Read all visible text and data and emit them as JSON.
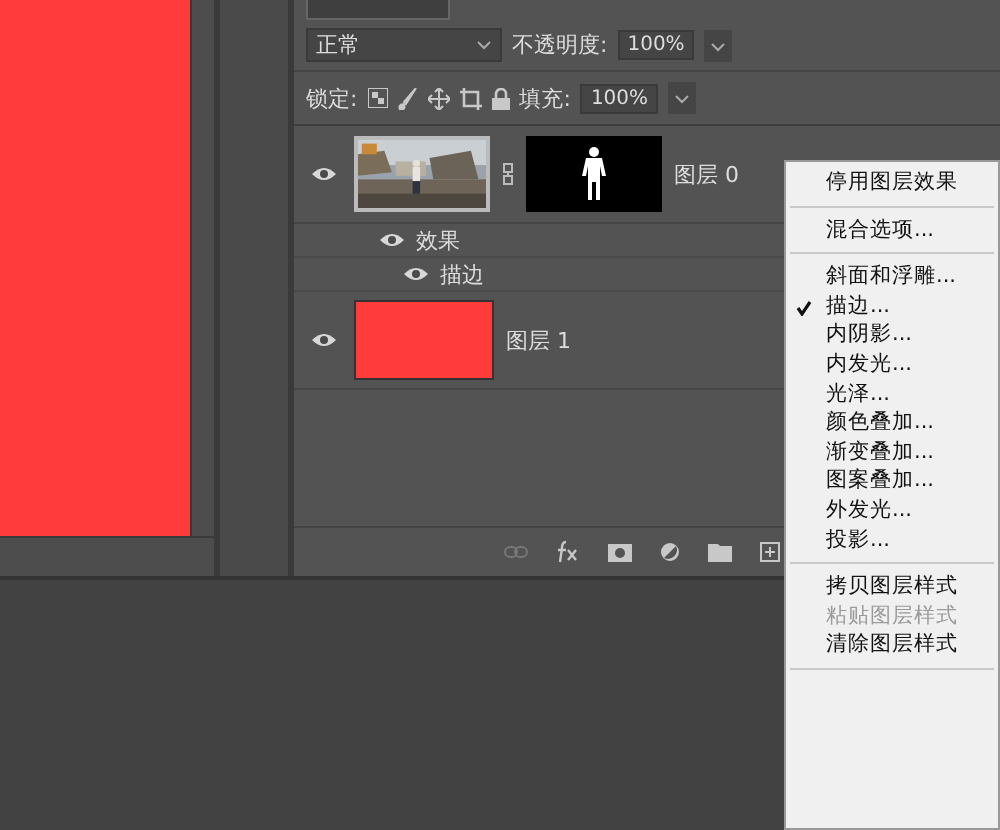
{
  "layers_panel": {
    "blend_mode": "正常",
    "opacity": {
      "label": "不透明度:",
      "value": "100%"
    },
    "lock": {
      "label": "锁定:"
    },
    "fill": {
      "label": "填充:",
      "value": "100%"
    },
    "layers": [
      {
        "name": "图层 0",
        "visible": true,
        "effects_label": "效果",
        "effects_visible": true,
        "effects": [
          {
            "name": "描边",
            "visible": true
          }
        ]
      },
      {
        "name": "图层 1",
        "kind": "solid",
        "visible": true
      }
    ]
  },
  "context_menu": [
    {
      "kind": "item",
      "label": "停用图层效果",
      "checked": false,
      "disabled": false
    },
    {
      "kind": "separator"
    },
    {
      "kind": "item",
      "label": "混合选项...",
      "checked": false,
      "disabled": false
    },
    {
      "kind": "separator"
    },
    {
      "kind": "item",
      "label": "斜面和浮雕...",
      "checked": false,
      "disabled": false
    },
    {
      "kind": "item",
      "label": "描边...",
      "checked": true,
      "disabled": false
    },
    {
      "kind": "item",
      "label": "内阴影...",
      "checked": false,
      "disabled": false
    },
    {
      "kind": "item",
      "label": "内发光...",
      "checked": false,
      "disabled": false
    },
    {
      "kind": "item",
      "label": "光泽...",
      "checked": false,
      "disabled": false
    },
    {
      "kind": "item",
      "label": "颜色叠加...",
      "checked": false,
      "disabled": false
    },
    {
      "kind": "item",
      "label": "渐变叠加...",
      "checked": false,
      "disabled": false
    },
    {
      "kind": "item",
      "label": "图案叠加...",
      "checked": false,
      "disabled": false
    },
    {
      "kind": "item",
      "label": "外发光...",
      "checked": false,
      "disabled": false
    },
    {
      "kind": "item",
      "label": "投影...",
      "checked": false,
      "disabled": false
    },
    {
      "kind": "separator"
    },
    {
      "kind": "item",
      "label": "拷贝图层样式",
      "checked": false,
      "disabled": false
    },
    {
      "kind": "item",
      "label": "粘贴图层样式",
      "checked": false,
      "disabled": true
    },
    {
      "kind": "item",
      "label": "清除图层样式",
      "checked": false,
      "disabled": false
    },
    {
      "kind": "separator"
    }
  ]
}
